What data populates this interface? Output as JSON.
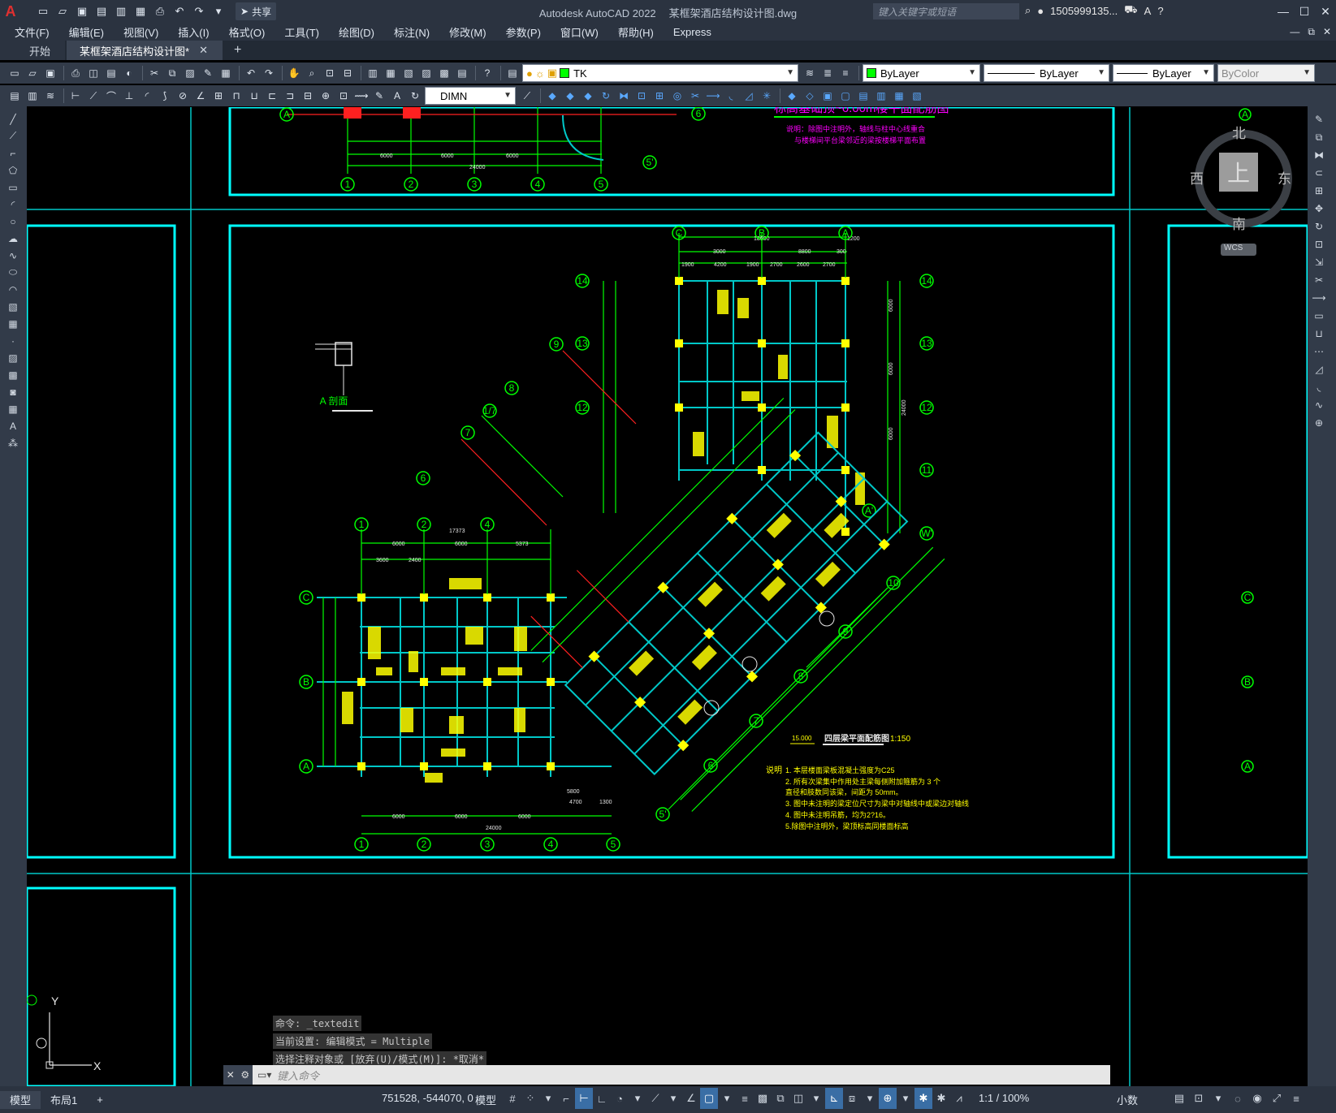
{
  "app": {
    "name": "Autodesk AutoCAD 2022",
    "file": "某框架酒店结构设计图.dwg",
    "share_label": "共享",
    "search_placeholder": "键入关键字或短语",
    "user": "1505999135...",
    "brand_color": "#e03030"
  },
  "menu": [
    "文件(F)",
    "编辑(E)",
    "视图(V)",
    "插入(I)",
    "格式(O)",
    "工具(T)",
    "绘图(D)",
    "标注(N)",
    "修改(M)",
    "参数(P)",
    "窗口(W)",
    "帮助(H)",
    "Express"
  ],
  "tabs": [
    {
      "label": "开始"
    },
    {
      "label": "某框架酒店结构设计图*"
    }
  ],
  "toolbar": {
    "layer": "TK",
    "color": "ByLayer",
    "linetype": "ByLayer",
    "lineweight": "ByLayer",
    "plotstyle": "ByColor",
    "dimstyle": "DIMN"
  },
  "viewcube": {
    "north": "北",
    "south": "南",
    "west": "西",
    "east": "东",
    "face": "上",
    "wcs": "WCS"
  },
  "drawing": {
    "top_title": "标高基础顶~6.00m楼平面配筋图",
    "top_note1": "说明：除图中注明外，轴线与柱中心线重合",
    "top_note2": "与楼梯间平台梁邻近的梁按楼梯平面布置",
    "main_title": "四层梁平面配筋图",
    "main_scale": "1:150",
    "elev": "15.000",
    "section_label": "A 剖面",
    "notes_title": "说明",
    "notes": [
      "1. 本层楼面梁板混凝土强度为C25",
      "2. 所有次梁集中作用处主梁每侧附加箍筋为 3 个",
      "   直径和肢数同该梁，间距为 50mm。",
      "3. 图中未注明的梁定位尺寸为梁中对轴线中或梁边对轴线",
      "4. 图中未注明吊筋，均为2?16。",
      "5.除图中注明外，梁顶标高同楼面标高"
    ],
    "left_axes_bottom": [
      "1",
      "2",
      "3",
      "4",
      "5"
    ],
    "left_axes_side": [
      "C",
      "B",
      "A"
    ],
    "right_axes_top": [
      "C",
      "B",
      "A"
    ],
    "right_axes_side": [
      "14",
      "13",
      "12",
      "11"
    ],
    "diag_axes": [
      "9",
      "8",
      "7",
      "6",
      "1/7",
      "10",
      "9",
      "8",
      "7",
      "6",
      "5'"
    ],
    "dims_top_left": [
      "6000",
      "6000",
      "5373",
      "17373",
      "3600",
      "2400"
    ],
    "dims_bottom_left": [
      "6000",
      "6000",
      "6000",
      "24000",
      "5800",
      "4700",
      "1300"
    ],
    "dims_top_right": [
      "18600",
      "1200",
      "3000",
      "8800",
      "300",
      "1900",
      "4200",
      "1900",
      "2700",
      "2600",
      "2700"
    ],
    "dims_right": [
      "6000",
      "6000",
      "6000",
      "24000"
    ],
    "top_dims": [
      "6000",
      "6000",
      "6000",
      "24000"
    ]
  },
  "command": {
    "history": [
      "命令: _textedit",
      "当前设置: 编辑模式 = Multiple",
      "选择注释对象或 [放弃(U)/模式(M)]: *取消*"
    ],
    "placeholder": "键入命令"
  },
  "status": {
    "tabs": [
      "模型",
      "布局1"
    ],
    "coords": "751528, -544070, 0",
    "model": "模型",
    "scale": "1:1 / 100%",
    "units": "小数"
  },
  "colors": {
    "frame": "#00ffff",
    "axis": "#00ff00",
    "beam": "#00c8c8",
    "text_yellow": "#ffff00",
    "title_magenta": "#ff00ff",
    "red": "#ff0000"
  }
}
